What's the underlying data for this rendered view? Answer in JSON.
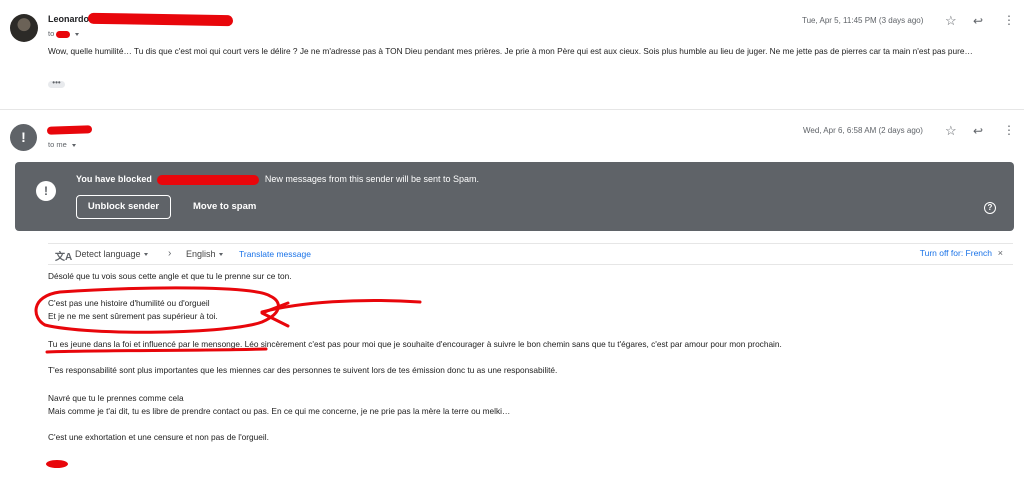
{
  "message1": {
    "sender": "Leonardo",
    "to_label": "to",
    "date": "Tue, Apr 5, 11:45 PM (3 days ago)",
    "body": "Wow, quelle humilité… Tu dis que c'est moi qui court vers le délire ? Je ne m'adresse pas à TON Dieu pendant mes prières. Je prie à mon Père qui est aux cieux. Sois plus humble au lieu de juger. Ne me jette pas de pierres car ta main n'est pas pure…",
    "trimmed": "•••"
  },
  "message2": {
    "to_label": "to me",
    "date": "Wed, Apr 6, 6:58 AM (2 days ago)"
  },
  "icons": {
    "star": "star-icon",
    "reply": "reply-icon",
    "more": "more-vert-icon",
    "alert": "alert-icon",
    "help": "help-icon",
    "translate": "translate-icon",
    "chevron": "chevron-right-icon",
    "close": "close-icon"
  },
  "banner": {
    "blocked_prefix": "You have blocked",
    "blocked_suffix": "New messages from this sender will be sent to Spam.",
    "unblock_label": "Unblock sender",
    "spam_label": "Move to spam"
  },
  "translate": {
    "detect": "Detect language",
    "target": "English",
    "action": "Translate message",
    "turn_off": "Turn off for: French"
  },
  "reply_body": {
    "line1": "Désolé que tu vois sous cette angle et que tu le prenne sur ce ton.",
    "line2": "C'est pas une histoire d'humilité ou d'orgueil",
    "line3": "Et je ne me sent sûrement pas supérieur à toi.",
    "line4": "Tu es jeune dans la foi et influencé par le mensonge. Léo sincèrement c'est pas pour moi que je souhaite d'encourager à suivre le bon chemin sans que tu t'égares, c'est par amour pour mon prochain.",
    "line5": "T'es responsabilité sont plus importantes que les miennes car des personnes te suivent lors de tes émission donc tu as une responsabilité.",
    "line6": "Navré que tu le prennes comme cela",
    "line7": "Mais comme je t'ai dit, tu es libre de prendre contact ou pas. En ce qui me concerne, je ne prie pas la mère la terre ou melki…",
    "line8": "C'est une exhortation et une censure et non pas de l'orgueil."
  },
  "colors": {
    "annotation_red": "#e8060b",
    "banner_bg": "#5f6368",
    "link_blue": "#1a73e8"
  }
}
